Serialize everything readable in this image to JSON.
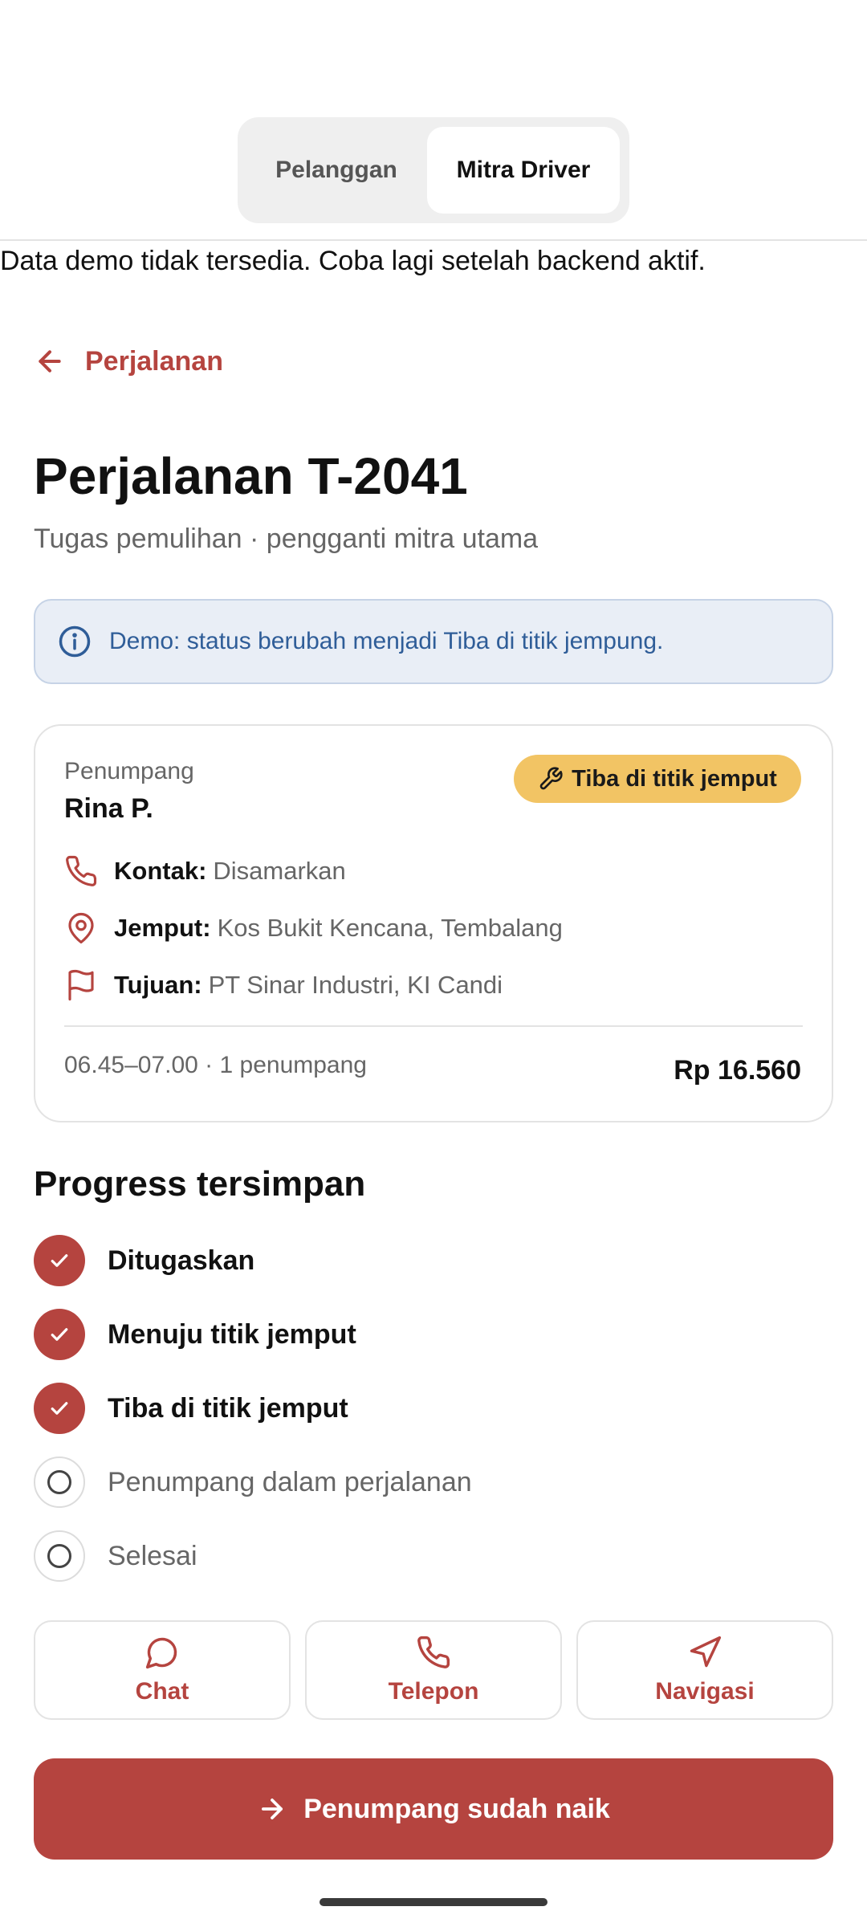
{
  "segmented": {
    "customer_label": "Pelanggan",
    "driver_label": "Mitra Driver",
    "selected": "Mitra Driver"
  },
  "notice": "Data demo tidak tersedia. Coba lagi setelah backend aktif.",
  "nav": {
    "back_label": "Perjalanan"
  },
  "header": {
    "title": "Perjalanan T-2041",
    "subtitle": "Tugas pemulihan · pengganti mitra utama"
  },
  "info_banner": "Demo: status berubah menjadi Tiba di titik jempung.",
  "trip_card": {
    "passenger_label": "Penumpang",
    "passenger_name": "Rina P.",
    "status_badge": "Tiba di titik jemput",
    "contact_key": "Kontak:",
    "contact_value": "Disamarkan",
    "pickup_key": "Jemput:",
    "pickup_value": "Kos Bukit Kencana, Tembalang",
    "dest_key": "Tujuan:",
    "dest_value": "PT Sinar Industri, KI Candi",
    "time_info": "06.45–07.00 · 1 penumpang",
    "price": "Rp 16.560"
  },
  "progress": {
    "title": "Progress tersimpan",
    "steps": [
      {
        "label": "Ditugaskan",
        "done": true
      },
      {
        "label": "Menuju titik jemput",
        "done": true
      },
      {
        "label": "Tiba di titik jemput",
        "done": true
      },
      {
        "label": "Penumpang dalam perjalanan",
        "done": false
      },
      {
        "label": "Selesai",
        "done": false
      }
    ]
  },
  "actions": {
    "chat": "Chat",
    "call": "Telepon",
    "navigate": "Navigasi"
  },
  "primary_action": "Penumpang sudah naik",
  "colors": {
    "accent": "#b5443f",
    "badge": "#f2c464",
    "info_bg": "#e9eef6",
    "info_text": "#2f5d98"
  }
}
